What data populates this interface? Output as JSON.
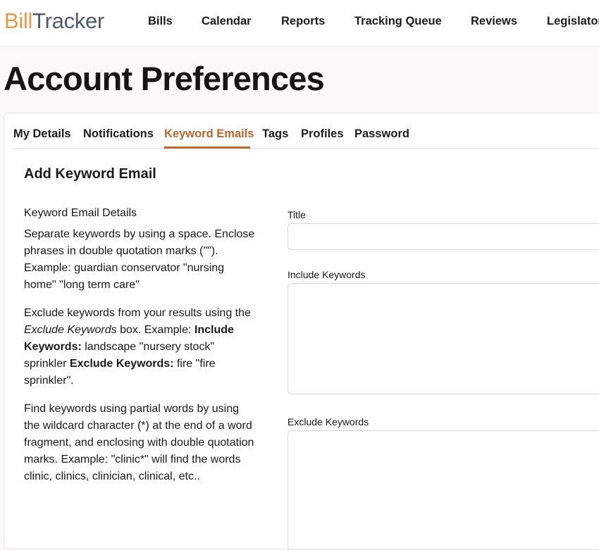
{
  "header": {
    "logo_part1": "Bill",
    "logo_part2": "Tracker",
    "nav": [
      "Bills",
      "Calendar",
      "Reports",
      "Tracking Queue",
      "Reviews",
      "Legislators"
    ]
  },
  "page": {
    "title": "Account Preferences"
  },
  "tabs": [
    {
      "label": "My Details",
      "active": false
    },
    {
      "label": "Notifications",
      "active": false
    },
    {
      "label": "Keyword Emails",
      "active": true
    },
    {
      "label": "Tags",
      "active": false
    },
    {
      "label": "Profiles",
      "active": false
    },
    {
      "label": "Password",
      "active": false
    }
  ],
  "form": {
    "section_title": "Add Keyword Email",
    "help": {
      "heading": "Keyword Email Details",
      "p1": "Separate keywords by using a space. Enclose phrases in double quotation marks (\"\"). Example: guardian conservator \"nursing home\" \"long term care\"",
      "p2": {
        "t1": "Exclude keywords from your results using the ",
        "em": "Exclude Keywords",
        "t2": " box. Example: ",
        "b1": "Include Keywords:",
        "t3": " landscape \"nursery stock\" sprinkler ",
        "b2": "Exclude Keywords:",
        "t4": " fire \"fire sprinkler\"."
      },
      "p3": "Find keywords using partial words by using the wildcard character (*) at the end of a word fragment, and enclosing with double quotation marks. Example: \"clinic*\" will find the words clinic, clinics, clinician, clinical, etc.."
    },
    "title_label": "Title",
    "title_value": "",
    "include_label": "Include Keywords",
    "include_value": "",
    "exclude_label": "Exclude Keywords",
    "exclude_value": ""
  },
  "colors": {
    "accent": "#c0652a",
    "logo_orange": "#e59a4a",
    "logo_slate": "#4e5a6e"
  }
}
